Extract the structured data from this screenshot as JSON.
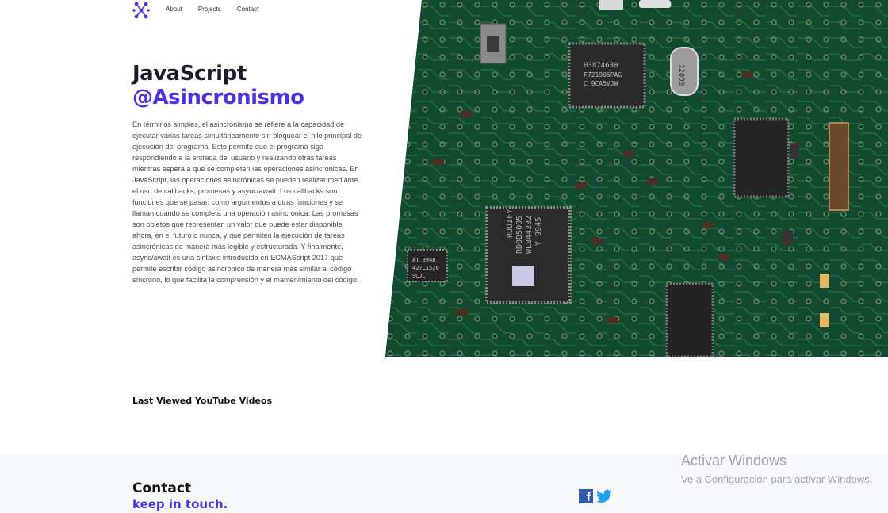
{
  "header": {
    "logo_icon": "molecule-logo-icon",
    "nav": [
      "About",
      "Projects",
      "Contact"
    ]
  },
  "hero": {
    "title_line1": "JavaScript",
    "title_line2": "@Asincronismo",
    "description": "En términos simples, el asincronismo se refiere a la capacidad de ejecutar varias tareas simultáneamente sin bloquear el hilo principal de ejecución del programa. Esto permite que el programa siga respondiendo a la entrada del usuario y realizando otras tareas mientras espera a que se completen las operaciones asincrónicas. En JavaScript, las operaciones asincrónicas se pueden realizar mediante el uso de callbacks, promesas y async/await. Los callbacks son funciones que se pasan como argumentos a otras funciones y se llaman cuando se completa una operación asincrónica. Las promesas son objetos que representan un valor que puede estar disponible ahora, en el futuro o nunca, y que permiten la ejecución de tareas asincrónicas de manera más legible y estructurada. Y finalmente, async/await es una sintaxis introducida en ECMAScript 2017 que permite escribir código asincrónico de manera más similar al código síncrono, lo que facilita la comprensión y el mantenimiento del código.",
    "image": "circuit-board-photo"
  },
  "board_labels": {
    "chip1": "03874600",
    "chip1b": "F721905PAG",
    "chip1c": "C 9CA5VJW",
    "chip2a": "RUOIFY",
    "chip2b": "RD0D5005",
    "chip2c": "WLB44232",
    "chip2d": "Y 9945",
    "chip3a": "AT 9948",
    "chip3b": "427L1520",
    "chip3c": "9CJC",
    "crystal": "12000"
  },
  "section": {
    "title": "Last Viewed YouTube Videos"
  },
  "footer": {
    "contact_title": "Contact",
    "contact_subtitle": "keep in touch.",
    "social": [
      "facebook-icon",
      "twitter-icon"
    ]
  },
  "watermark": {
    "line1": "Activar Windows",
    "line2": "Ve a Configuración para activar Windows."
  },
  "colors": {
    "accent": "#4c33e0",
    "board_green": "#0f3f29",
    "footer_bg": "#f7f8fa"
  }
}
